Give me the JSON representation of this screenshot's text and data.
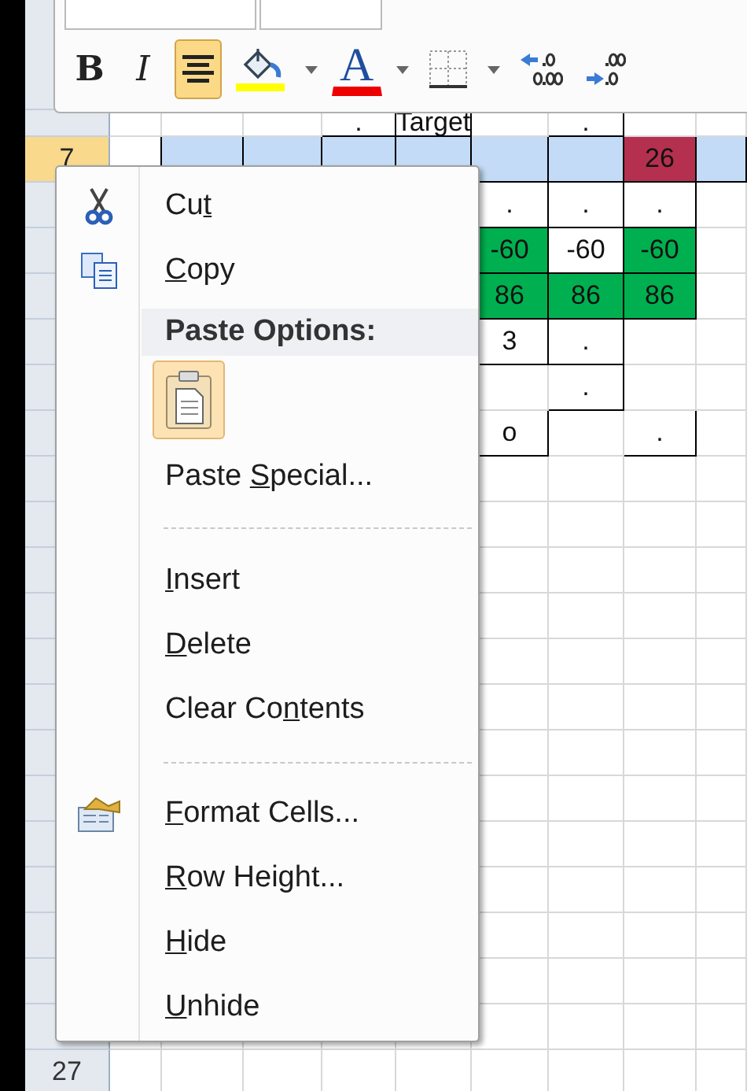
{
  "toolbar": {
    "buttons": [
      {
        "kind": "bold",
        "label": "B",
        "selected": false
      },
      {
        "kind": "italic",
        "label": "I",
        "selected": false
      },
      {
        "kind": "center",
        "selected": true
      },
      {
        "kind": "fill",
        "selected": false
      },
      {
        "kind": "caret",
        "selected": false
      },
      {
        "kind": "font-color",
        "label": "A",
        "selected": false
      },
      {
        "kind": "caret",
        "selected": false
      },
      {
        "kind": "borders",
        "selected": false
      },
      {
        "kind": "caret",
        "selected": false
      },
      {
        "kind": "increase-decimal",
        "selected": false
      },
      {
        "kind": "decrease-decimal",
        "selected": false
      }
    ]
  },
  "sheet": {
    "rows": [
      {
        "selected": false,
        "cells": [
          {},
          {},
          {},
          {
            "text": "."
          },
          {
            "text": "Target"
          },
          {},
          {
            "text": "."
          },
          {},
          {}
        ]
      },
      {
        "header": "7",
        "selected": true,
        "cells": [
          {
            "active": true
          },
          {},
          {},
          {},
          {},
          {},
          {},
          {
            "text": "26",
            "color": "#b5304f"
          },
          {}
        ]
      },
      {
        "selected": false,
        "cells": [
          {},
          {},
          {},
          {},
          {},
          {
            "text": "."
          },
          {
            "text": "."
          },
          {
            "text": "."
          },
          {}
        ]
      },
      {
        "selected": false,
        "cells": [
          {},
          {},
          {},
          {},
          {},
          {
            "text": "-60",
            "color": "#00b050"
          },
          {
            "text": "-60"
          },
          {
            "text": "-60",
            "color": "#00b050"
          },
          {}
        ]
      },
      {
        "selected": false,
        "cells": [
          {},
          {},
          {},
          {},
          {},
          {
            "text": "86",
            "color": "#00b050"
          },
          {
            "text": "86",
            "color": "#00b050"
          },
          {
            "text": "86",
            "color": "#00b050"
          },
          {}
        ]
      },
      {
        "selected": false,
        "cells": [
          {},
          {},
          {},
          {},
          {},
          {
            "text": "3"
          },
          {
            "text": "."
          },
          {},
          {}
        ]
      },
      {
        "selected": false,
        "cells": [
          {},
          {},
          {},
          {},
          {},
          {},
          {
            "text": "."
          },
          {},
          {}
        ]
      },
      {
        "selected": false,
        "cells": [
          {},
          {},
          {},
          {},
          {},
          {
            "text": "o"
          },
          {},
          {
            "text": "."
          },
          {}
        ]
      }
    ],
    "bottom_row": {
      "header": "27",
      "selected": false
    }
  },
  "context_menu": {
    "items": [
      {
        "kind": "cut",
        "before": "Cu",
        "key": "t"
      },
      {
        "kind": "copy",
        "key": "C",
        "after": "opy"
      },
      {
        "kind": "paste-header",
        "label": "Paste Options:"
      },
      {
        "kind": "paste-button"
      },
      {
        "kind": "command",
        "before": "Paste ",
        "key": "S",
        "after": "pecial..."
      },
      {
        "kind": "separator"
      },
      {
        "kind": "command",
        "key": "I",
        "after": "nsert"
      },
      {
        "kind": "command",
        "key": "D",
        "after": "elete"
      },
      {
        "kind": "command",
        "before": "Clear Co",
        "key": "n",
        "after": "tents"
      },
      {
        "kind": "separator"
      },
      {
        "kind": "format",
        "key": "F",
        "after": "ormat Cells..."
      },
      {
        "kind": "command",
        "key": "R",
        "after": "ow Height..."
      },
      {
        "kind": "command",
        "key": "H",
        "after": "ide"
      },
      {
        "kind": "command",
        "key": "U",
        "after": "nhide"
      }
    ]
  }
}
